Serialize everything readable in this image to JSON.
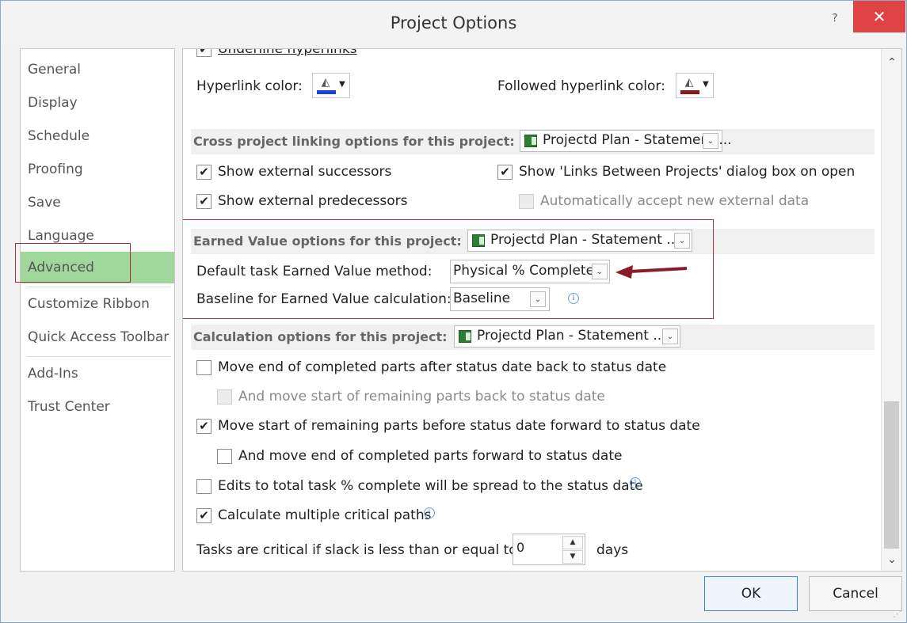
{
  "window": {
    "title": "Project Options",
    "help_label": "?",
    "close_label": "✕"
  },
  "sidebar": {
    "items": [
      {
        "label": "General"
      },
      {
        "label": "Display"
      },
      {
        "label": "Schedule"
      },
      {
        "label": "Proofing"
      },
      {
        "label": "Save"
      },
      {
        "label": "Language"
      },
      {
        "label": "Advanced",
        "selected": true
      },
      {
        "label": "Customize Ribbon"
      },
      {
        "label": "Quick Access Toolbar"
      },
      {
        "label": "Add-Ins"
      },
      {
        "label": "Trust Center"
      }
    ]
  },
  "hyperlinks": {
    "underline_label": "Underline hyperlinks",
    "hyperlink_color_label": "Hyperlink color:",
    "hyperlink_color": "#1f3fd0",
    "followed_color_label": "Followed hyperlink color:",
    "followed_color": "#8b1a1a"
  },
  "cross_project": {
    "section_label": "Cross project linking options for this project:",
    "project_value": "Projectd Plan - Statement ...",
    "show_successors_label": "Show external successors",
    "show_successors_checked": true,
    "show_predecessors_label": "Show external predecessors",
    "show_predecessors_checked": true,
    "show_links_dialog_label": "Show 'Links Between Projects' dialog box on open",
    "show_links_dialog_checked": true,
    "auto_accept_label": "Automatically accept new external data",
    "auto_accept_checked": false
  },
  "earned_value": {
    "section_label": "Earned Value options for this project:",
    "project_value": "Projectd Plan - Statement ...",
    "default_method_label": "Default task Earned Value method:",
    "default_method_value": "Physical % Complete",
    "baseline_label": "Baseline for Earned Value calculation:",
    "baseline_value": "Baseline"
  },
  "calculation": {
    "section_label": "Calculation options for this project:",
    "project_value": "Projectd Plan - Statement ...",
    "options": [
      {
        "label": "Move end of completed parts after status date back to status date",
        "checked": false,
        "disabled": false
      },
      {
        "label": "And move start of remaining parts back to status date",
        "checked": false,
        "disabled": true
      },
      {
        "label": "Move start of remaining parts before status date forward to status date",
        "checked": true,
        "disabled": false
      },
      {
        "label": "And move end of completed parts forward to status date",
        "checked": false,
        "disabled": false
      },
      {
        "label": "Edits to total task % complete will be spread to the status date",
        "checked": false,
        "disabled": false
      },
      {
        "label": "Calculate multiple critical paths",
        "checked": true,
        "disabled": false
      }
    ],
    "slack_label": "Tasks are critical if slack is less than or equal to",
    "slack_value": "0",
    "slack_unit": "days"
  },
  "footer": {
    "ok_label": "OK",
    "cancel_label": "Cancel"
  },
  "glyphs": {
    "check": "✔",
    "dropdown": "⌄",
    "caret": "▼",
    "bucket": "◭",
    "scroll_up": "⌃",
    "scroll_down": "⌄",
    "spin_up": "▲",
    "spin_down": "▼",
    "info": "i",
    "grip": "⋰"
  },
  "colors": {
    "selected_nav": "#9fd89a",
    "highlight_border": "#a03040",
    "default_button_border": "#3b84d6"
  }
}
